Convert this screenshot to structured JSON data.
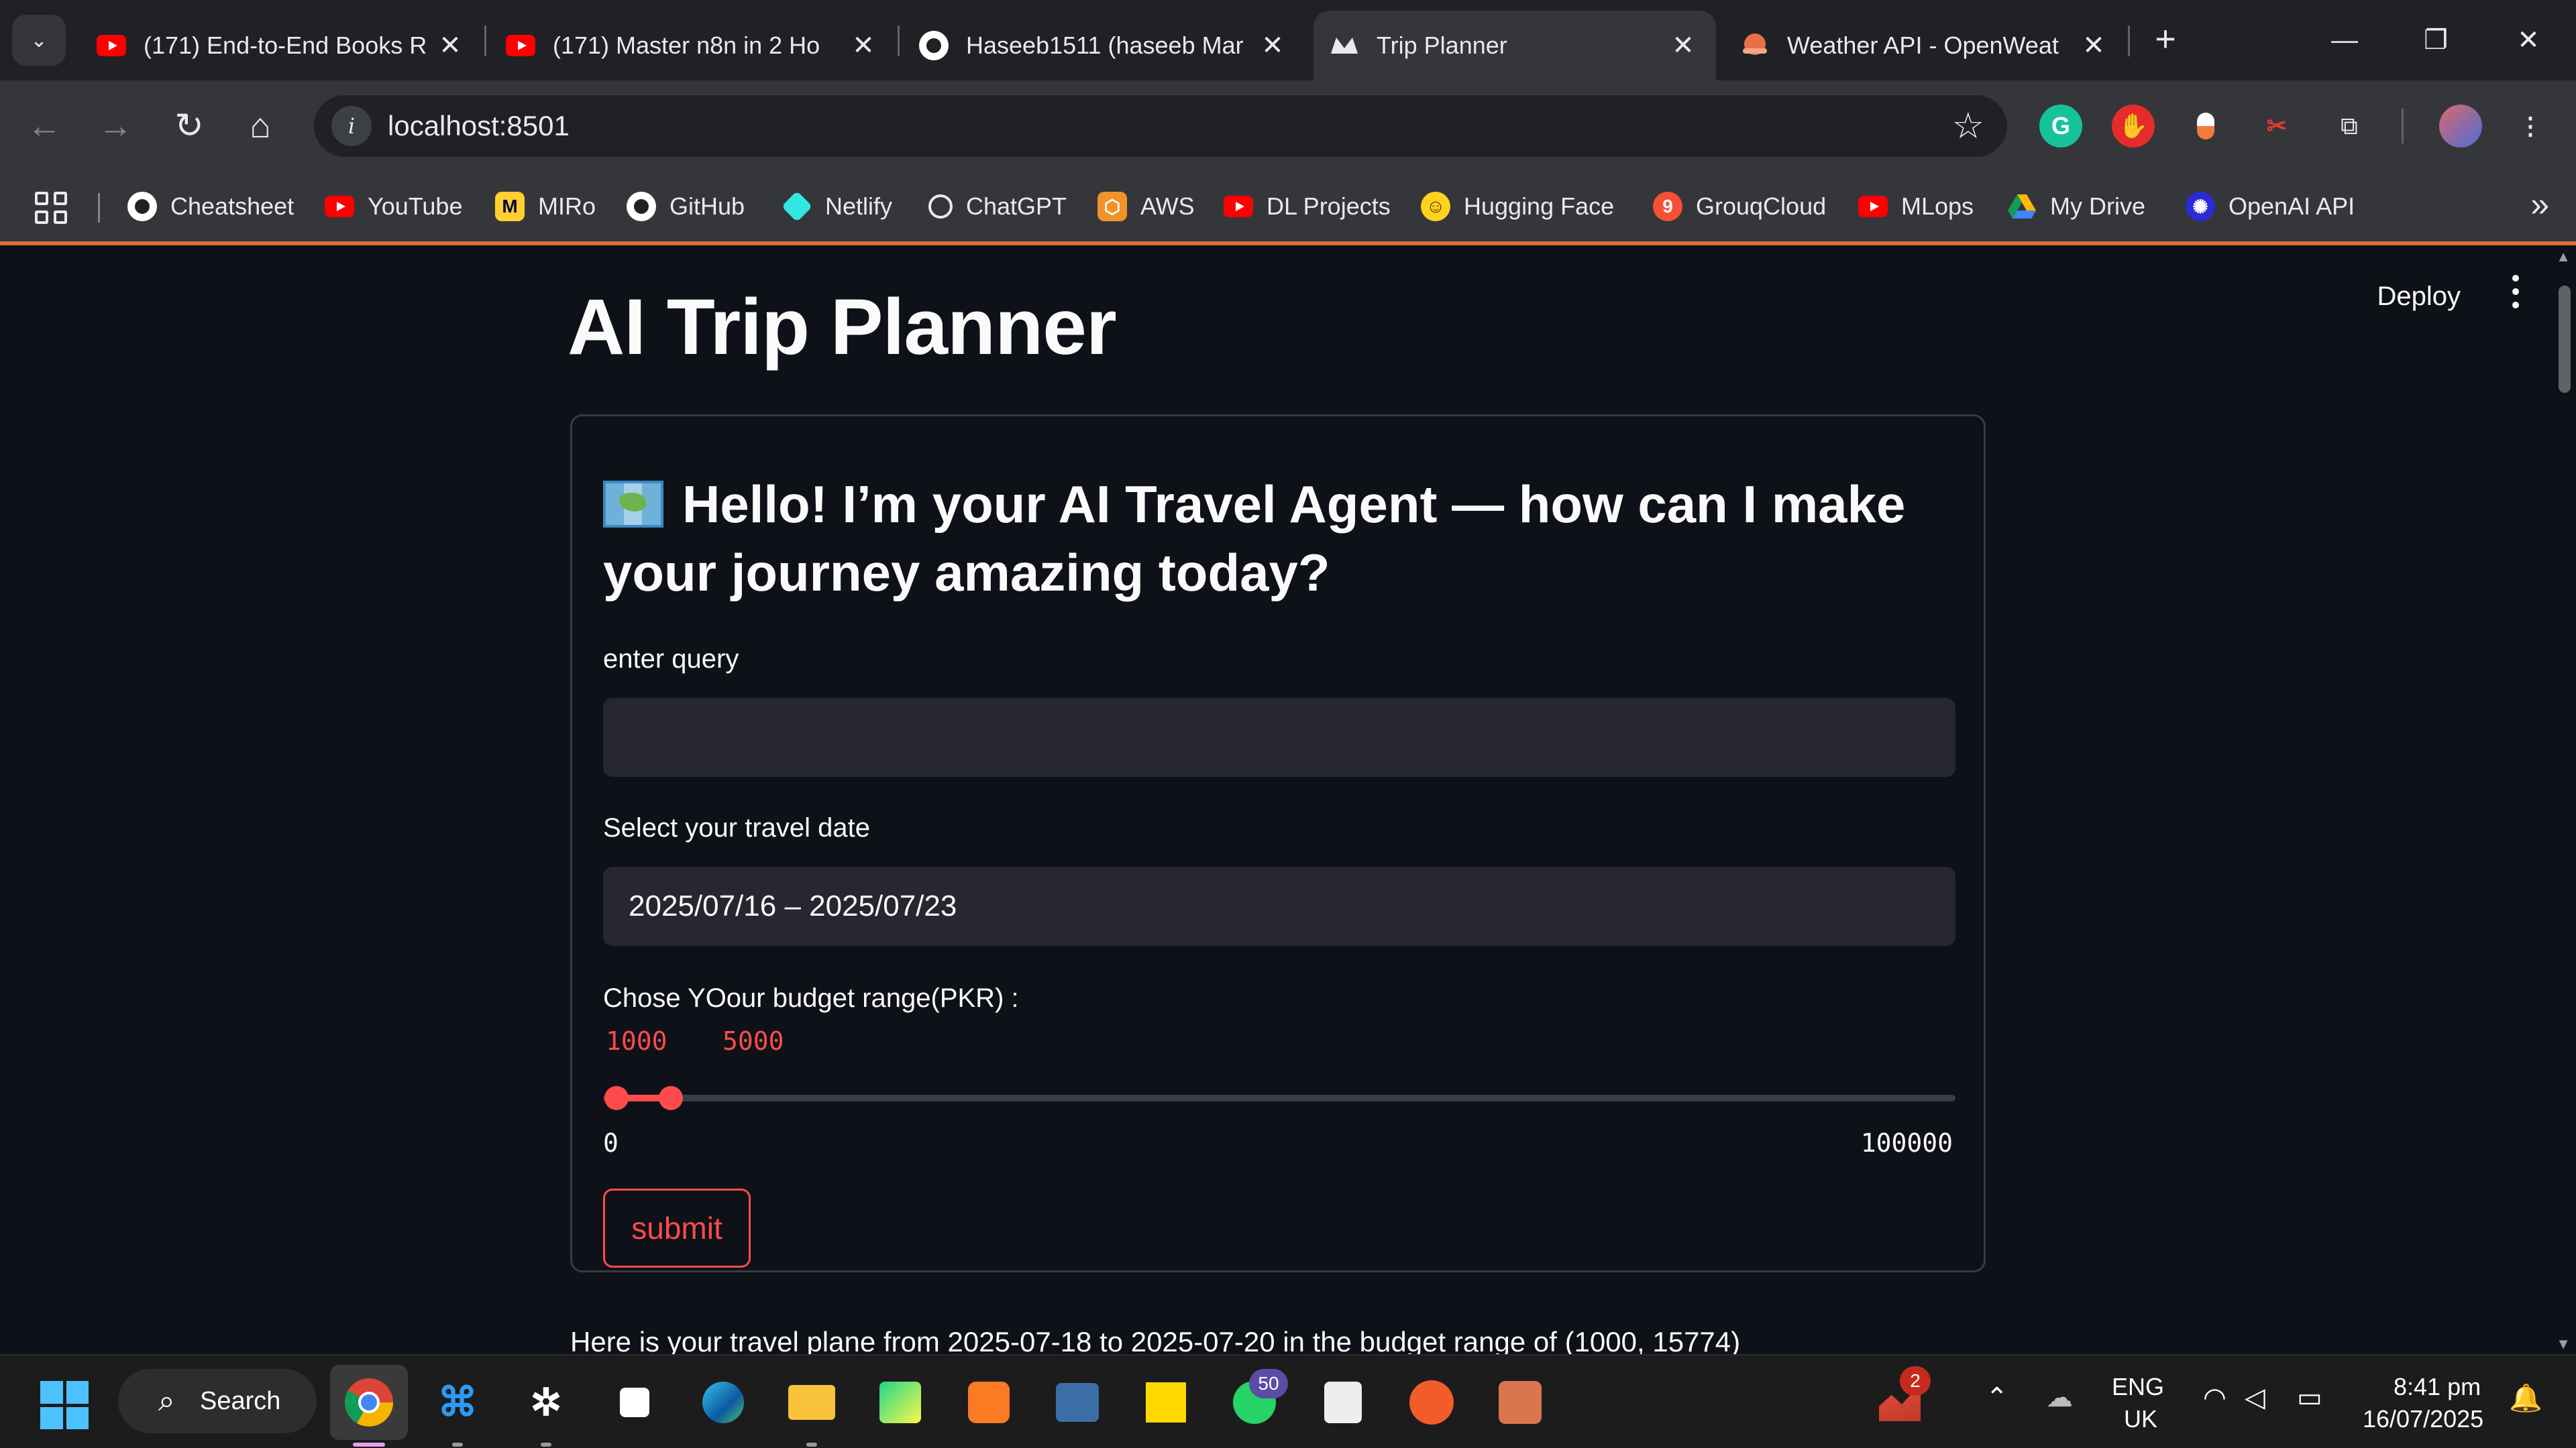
{
  "browser": {
    "tabs": [
      {
        "title": "(171) End-to-End Books R",
        "icon": "youtube-icon"
      },
      {
        "title": "(171) Master n8n in 2 Ho",
        "icon": "youtube-icon"
      },
      {
        "title": "Haseeb1511 (haseeb Mar",
        "icon": "github-icon"
      },
      {
        "title": "Trip Planner",
        "icon": "streamlit-icon",
        "active": true
      },
      {
        "title": "Weather API - OpenWeat",
        "icon": "openweather-icon"
      }
    ],
    "address": "localhost:8501",
    "bookmarks": [
      {
        "label": "Cheatsheet",
        "icon": "github-icon"
      },
      {
        "label": "YouTube",
        "icon": "youtube-icon"
      },
      {
        "label": "MIRo",
        "icon": "miro-icon"
      },
      {
        "label": "GitHub",
        "icon": "github-icon"
      },
      {
        "label": "Netlify",
        "icon": "netlify-icon"
      },
      {
        "label": "ChatGPT",
        "icon": "chatgpt-icon"
      },
      {
        "label": "AWS",
        "icon": "aws-icon"
      },
      {
        "label": "DL Projects",
        "icon": "youtube-icon"
      },
      {
        "label": "Hugging Face",
        "icon": "hugging-face-icon"
      },
      {
        "label": "GrouqCloud",
        "icon": "groq-icon"
      },
      {
        "label": "MLops",
        "icon": "youtube-icon"
      },
      {
        "label": "My Drive",
        "icon": "google-drive-icon"
      },
      {
        "label": "OpenAI API",
        "icon": "openai-icon"
      }
    ]
  },
  "app": {
    "deploy_label": "Deploy",
    "title": "AI Trip Planner",
    "form": {
      "heading": "Hello! I’m your AI Travel Agent — how can I make your journey amazing today?",
      "query_label": "enter query",
      "query_value": "",
      "date_label": "Select your travel date",
      "date_value": "2025/07/16 – 2025/07/23",
      "budget_label": "Chose YOour budget range(PKR) :",
      "budget_low": "1000",
      "budget_high": "5000",
      "budget_min": "0",
      "budget_max": "100000",
      "submit_label": "submit"
    },
    "result_text": "Here is your travel plane from 2025-07-18 to 2025-07-20 in the budget range of (1000, 15774)"
  },
  "taskbar": {
    "search_label": "Search",
    "whatsapp_badge": "50",
    "notif_badge": "2",
    "lang_top": "ENG",
    "lang_bottom": "UK",
    "time": "8:41 pm",
    "date": "16/07/2025"
  },
  "colors": {
    "accent": "#ff4b4b",
    "background": "#0e1117",
    "input_bg": "#262730"
  }
}
